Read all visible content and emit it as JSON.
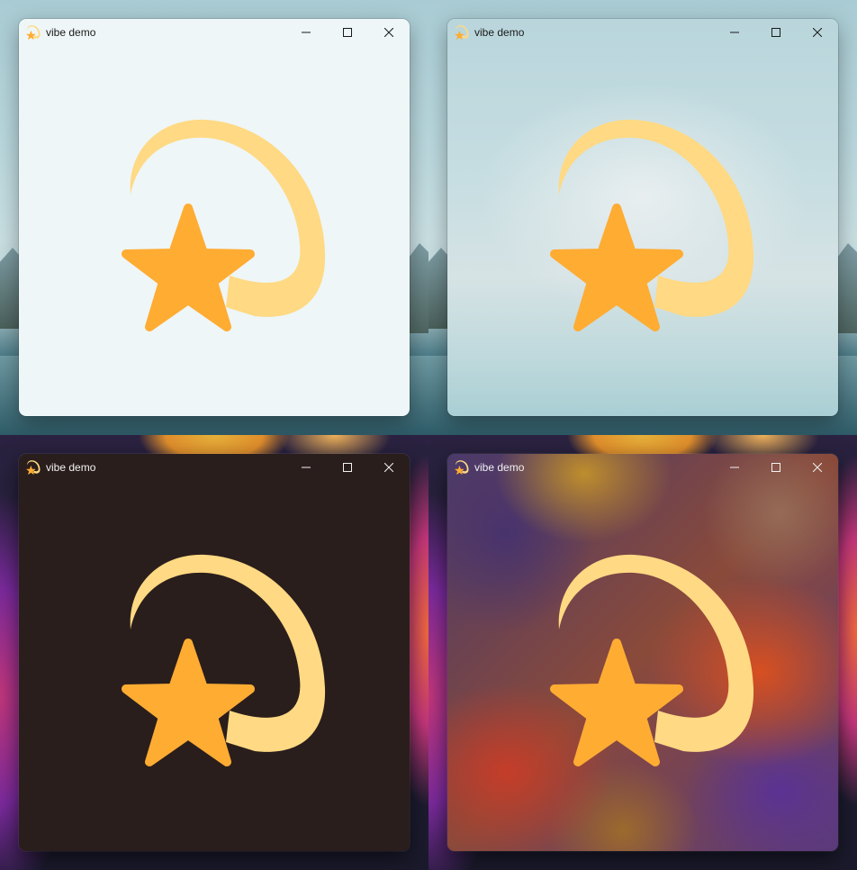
{
  "windows": [
    {
      "title": "vibe demo",
      "theme": "light",
      "backdrop": "mica"
    },
    {
      "title": "vibe demo",
      "theme": "light",
      "backdrop": "acrylic"
    },
    {
      "title": "vibe demo",
      "theme": "dark",
      "backdrop": "mica"
    },
    {
      "title": "vibe demo",
      "theme": "dark",
      "backdrop": "acrylic"
    }
  ],
  "icons": {
    "app": "shooting-star-icon",
    "minimize": "minimize-icon",
    "maximize": "maximize-icon",
    "close": "close-icon",
    "logo": "shooting-star-icon"
  },
  "colors": {
    "star": "#ffac33",
    "tail": "#ffd983",
    "light_mica_bg": "#eef6f7",
    "dark_mica_bg": "#2a1e1c"
  }
}
